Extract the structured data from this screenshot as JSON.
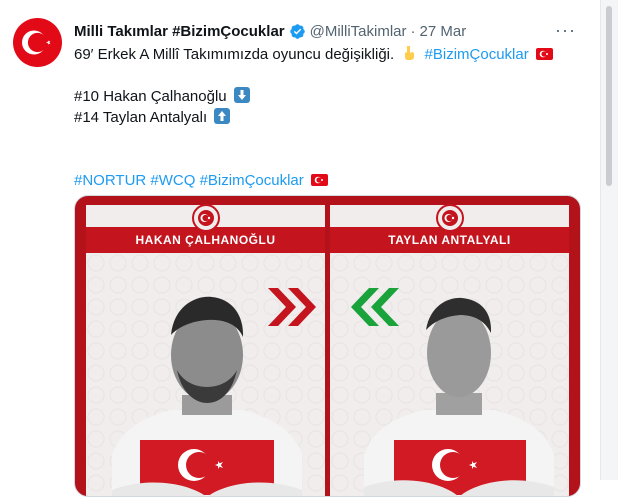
{
  "tweet": {
    "author_name": "Milli Takımlar #BizimÇocuklar",
    "handle": "@MilliTakimlar",
    "separator": "·",
    "date": "27 Mar",
    "more": "···",
    "line1_text": "69′ Erkek A Millî Takımımızda oyuncu değişikliği.",
    "line1_tag": "#BizimÇocuklar",
    "player_out": "#10 Hakan Çalhanoğlu",
    "player_in": "#14 Taylan Antalyalı",
    "tags": [
      "#NORTUR",
      "#WCQ",
      "#BizimÇocuklar"
    ]
  },
  "media": {
    "left_name": "HAKAN ÇALHANOĞLU",
    "right_name": "TAYLAN ANTALYALI",
    "colors": {
      "red": "#c4141e",
      "green": "#1aa33a",
      "dark_red": "#b3121b"
    }
  }
}
